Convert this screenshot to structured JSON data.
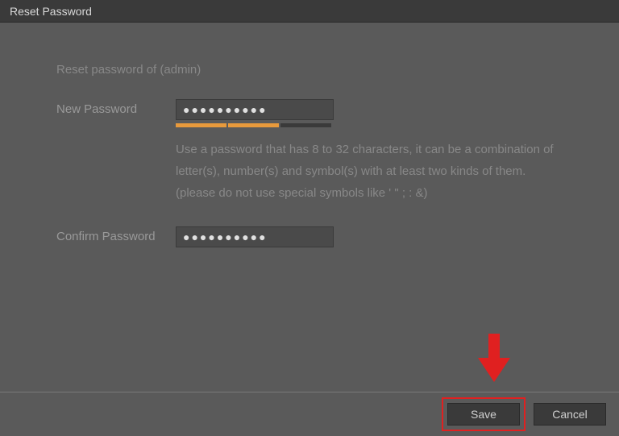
{
  "header": {
    "title": "Reset Password"
  },
  "form": {
    "subtitle": "Reset password of (admin)",
    "new_password_label": "New Password",
    "new_password_value": "●●●●●●●●●●",
    "confirm_password_label": "Confirm Password",
    "confirm_password_value": "●●●●●●●●●●",
    "hint": "Use a password that has 8 to 32 characters, it can be a combination of letter(s), number(s) and symbol(s) with at least two kinds of them.(please do not use special symbols like ' \" ; : &)",
    "strength_filled": 2,
    "strength_total": 3
  },
  "footer": {
    "save_label": "Save",
    "cancel_label": "Cancel"
  }
}
